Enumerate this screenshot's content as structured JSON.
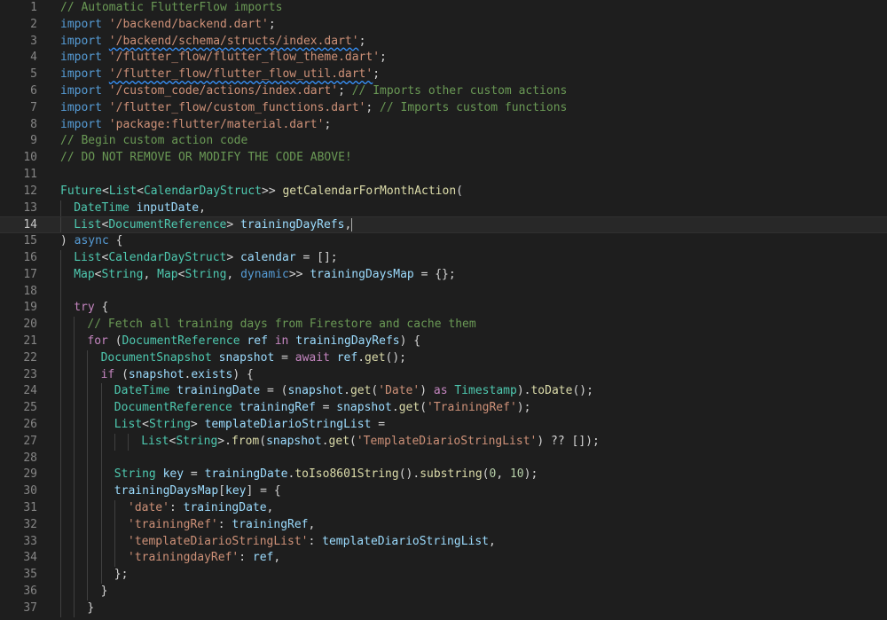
{
  "editor": {
    "current_line": 14,
    "colors": {
      "background": "#1e1e1e",
      "comment": "#6a9955",
      "keyword": "#569cd6",
      "control": "#c586c0",
      "string": "#ce9178",
      "type": "#4ec9b0",
      "function": "#dcdcaa",
      "variable": "#9cdcfe",
      "number": "#b5cea8",
      "plain": "#d4d4d4"
    },
    "lines": [
      {
        "n": "1",
        "tokens": [
          [
            "com",
            "// Automatic FlutterFlow imports"
          ]
        ]
      },
      {
        "n": "2",
        "tokens": [
          [
            "kw",
            "import"
          ],
          [
            "pun",
            " "
          ],
          [
            "str",
            "'/backend/backend.dart'"
          ],
          [
            "pun",
            ";"
          ]
        ]
      },
      {
        "n": "3",
        "tokens": [
          [
            "kw",
            "import"
          ],
          [
            "pun",
            " "
          ],
          [
            "str",
            "'/backend/schema/structs/index.dart'",
            "squig"
          ],
          [
            "pun",
            ";"
          ]
        ]
      },
      {
        "n": "4",
        "tokens": [
          [
            "kw",
            "import"
          ],
          [
            "pun",
            " "
          ],
          [
            "str",
            "'/flutter_flow/flutter_flow_theme.dart'"
          ],
          [
            "pun",
            ";"
          ]
        ]
      },
      {
        "n": "5",
        "tokens": [
          [
            "kw",
            "import"
          ],
          [
            "pun",
            " "
          ],
          [
            "str",
            "'/flutter_flow/flutter_flow_util.dart'",
            "squig"
          ],
          [
            "pun",
            ";"
          ]
        ]
      },
      {
        "n": "6",
        "tokens": [
          [
            "kw",
            "import"
          ],
          [
            "pun",
            " "
          ],
          [
            "str",
            "'/custom_code/actions/index.dart'"
          ],
          [
            "pun",
            "; "
          ],
          [
            "com",
            "// Imports other custom actions"
          ]
        ]
      },
      {
        "n": "7",
        "tokens": [
          [
            "kw",
            "import"
          ],
          [
            "pun",
            " "
          ],
          [
            "str",
            "'/flutter_flow/custom_functions.dart'"
          ],
          [
            "pun",
            "; "
          ],
          [
            "com",
            "// Imports custom functions"
          ]
        ]
      },
      {
        "n": "8",
        "tokens": [
          [
            "kw",
            "import"
          ],
          [
            "pun",
            " "
          ],
          [
            "str",
            "'package:flutter/material.dart'"
          ],
          [
            "pun",
            ";"
          ]
        ]
      },
      {
        "n": "9",
        "tokens": [
          [
            "com",
            "// Begin custom action code"
          ]
        ]
      },
      {
        "n": "10",
        "tokens": [
          [
            "com",
            "// DO NOT REMOVE OR MODIFY THE CODE ABOVE!"
          ]
        ]
      },
      {
        "n": "11",
        "tokens": []
      },
      {
        "n": "12",
        "tokens": [
          [
            "typ",
            "Future"
          ],
          [
            "pun",
            "<"
          ],
          [
            "typ",
            "List"
          ],
          [
            "pun",
            "<"
          ],
          [
            "typ",
            "CalendarDayStruct"
          ],
          [
            "pun",
            ">> "
          ],
          [
            "fn",
            "getCalendarForMonthAction"
          ],
          [
            "pun",
            "("
          ]
        ]
      },
      {
        "n": "13",
        "indent": 1,
        "tokens": [
          [
            "typ",
            "DateTime"
          ],
          [
            "pun",
            " "
          ],
          [
            "var",
            "inputDate"
          ],
          [
            "pun",
            ","
          ]
        ]
      },
      {
        "n": "14",
        "indent": 1,
        "tokens": [
          [
            "typ",
            "List"
          ],
          [
            "pun",
            "<"
          ],
          [
            "typ",
            "DocumentReference"
          ],
          [
            "pun",
            "> "
          ],
          [
            "var",
            "trainingDayRefs"
          ],
          [
            "pun",
            ","
          ]
        ],
        "cursor": true
      },
      {
        "n": "15",
        "tokens": [
          [
            "pun",
            ") "
          ],
          [
            "kw",
            "async"
          ],
          [
            "pun",
            " {"
          ]
        ]
      },
      {
        "n": "16",
        "indent": 1,
        "tokens": [
          [
            "typ",
            "List"
          ],
          [
            "pun",
            "<"
          ],
          [
            "typ",
            "CalendarDayStruct"
          ],
          [
            "pun",
            "> "
          ],
          [
            "var",
            "calendar"
          ],
          [
            "pun",
            " = [];"
          ]
        ]
      },
      {
        "n": "17",
        "indent": 1,
        "tokens": [
          [
            "typ",
            "Map"
          ],
          [
            "pun",
            "<"
          ],
          [
            "typ",
            "String"
          ],
          [
            "pun",
            ", "
          ],
          [
            "typ",
            "Map"
          ],
          [
            "pun",
            "<"
          ],
          [
            "typ",
            "String"
          ],
          [
            "pun",
            ", "
          ],
          [
            "kw",
            "dynamic"
          ],
          [
            "pun",
            ">> "
          ],
          [
            "var",
            "trainingDaysMap"
          ],
          [
            "pun",
            " = {};"
          ]
        ]
      },
      {
        "n": "18",
        "indent": 1,
        "tokens": []
      },
      {
        "n": "19",
        "indent": 1,
        "tokens": [
          [
            "ctl",
            "try"
          ],
          [
            "pun",
            " {"
          ]
        ]
      },
      {
        "n": "20",
        "indent": 2,
        "tokens": [
          [
            "com",
            "// Fetch all training days from Firestore and cache them"
          ]
        ]
      },
      {
        "n": "21",
        "indent": 2,
        "tokens": [
          [
            "ctl",
            "for"
          ],
          [
            "pun",
            " ("
          ],
          [
            "typ",
            "DocumentReference"
          ],
          [
            "pun",
            " "
          ],
          [
            "var",
            "ref"
          ],
          [
            "pun",
            " "
          ],
          [
            "ctl",
            "in"
          ],
          [
            "pun",
            " "
          ],
          [
            "var",
            "trainingDayRefs"
          ],
          [
            "pun",
            ") {"
          ]
        ]
      },
      {
        "n": "22",
        "indent": 3,
        "tokens": [
          [
            "typ",
            "DocumentSnapshot"
          ],
          [
            "pun",
            " "
          ],
          [
            "var",
            "snapshot"
          ],
          [
            "pun",
            " = "
          ],
          [
            "ctl",
            "await"
          ],
          [
            "pun",
            " "
          ],
          [
            "var",
            "ref"
          ],
          [
            "pun",
            "."
          ],
          [
            "fn",
            "get"
          ],
          [
            "pun",
            "();"
          ]
        ]
      },
      {
        "n": "23",
        "indent": 3,
        "tokens": [
          [
            "ctl",
            "if"
          ],
          [
            "pun",
            " ("
          ],
          [
            "var",
            "snapshot"
          ],
          [
            "pun",
            "."
          ],
          [
            "var",
            "exists"
          ],
          [
            "pun",
            ") {"
          ]
        ]
      },
      {
        "n": "24",
        "indent": 4,
        "tokens": [
          [
            "typ",
            "DateTime"
          ],
          [
            "pun",
            " "
          ],
          [
            "var",
            "trainingDate"
          ],
          [
            "pun",
            " = ("
          ],
          [
            "var",
            "snapshot"
          ],
          [
            "pun",
            "."
          ],
          [
            "fn",
            "get"
          ],
          [
            "pun",
            "("
          ],
          [
            "str",
            "'Date'"
          ],
          [
            "pun",
            ") "
          ],
          [
            "ctl",
            "as"
          ],
          [
            "pun",
            " "
          ],
          [
            "typ",
            "Timestamp"
          ],
          [
            "pun",
            ")."
          ],
          [
            "fn",
            "toDate"
          ],
          [
            "pun",
            "();"
          ]
        ]
      },
      {
        "n": "25",
        "indent": 4,
        "tokens": [
          [
            "typ",
            "DocumentReference"
          ],
          [
            "pun",
            " "
          ],
          [
            "var",
            "trainingRef"
          ],
          [
            "pun",
            " = "
          ],
          [
            "var",
            "snapshot"
          ],
          [
            "pun",
            "."
          ],
          [
            "fn",
            "get"
          ],
          [
            "pun",
            "("
          ],
          [
            "str",
            "'TrainingRef'"
          ],
          [
            "pun",
            ");"
          ]
        ]
      },
      {
        "n": "26",
        "indent": 4,
        "tokens": [
          [
            "typ",
            "List"
          ],
          [
            "pun",
            "<"
          ],
          [
            "typ",
            "String"
          ],
          [
            "pun",
            "> "
          ],
          [
            "var",
            "templateDiarioStringList"
          ],
          [
            "pun",
            " ="
          ]
        ]
      },
      {
        "n": "27",
        "indent": 6,
        "tokens": [
          [
            "typ",
            "List"
          ],
          [
            "pun",
            "<"
          ],
          [
            "typ",
            "String"
          ],
          [
            "pun",
            ">."
          ],
          [
            "fn",
            "from"
          ],
          [
            "pun",
            "("
          ],
          [
            "var",
            "snapshot"
          ],
          [
            "pun",
            "."
          ],
          [
            "fn",
            "get"
          ],
          [
            "pun",
            "("
          ],
          [
            "str",
            "'TemplateDiarioStringList'"
          ],
          [
            "pun",
            ") ?? []);"
          ]
        ]
      },
      {
        "n": "28",
        "indent": 4,
        "tokens": []
      },
      {
        "n": "29",
        "indent": 4,
        "tokens": [
          [
            "typ",
            "String"
          ],
          [
            "pun",
            " "
          ],
          [
            "var",
            "key"
          ],
          [
            "pun",
            " = "
          ],
          [
            "var",
            "trainingDate"
          ],
          [
            "pun",
            "."
          ],
          [
            "fn",
            "toIso8601String"
          ],
          [
            "pun",
            "()."
          ],
          [
            "fn",
            "substring"
          ],
          [
            "pun",
            "("
          ],
          [
            "num",
            "0"
          ],
          [
            "pun",
            ", "
          ],
          [
            "num",
            "10"
          ],
          [
            "pun",
            ");"
          ]
        ]
      },
      {
        "n": "30",
        "indent": 4,
        "tokens": [
          [
            "var",
            "trainingDaysMap"
          ],
          [
            "pun",
            "["
          ],
          [
            "var",
            "key"
          ],
          [
            "pun",
            "] = {"
          ]
        ]
      },
      {
        "n": "31",
        "indent": 5,
        "tokens": [
          [
            "str",
            "'date'"
          ],
          [
            "pun",
            ": "
          ],
          [
            "var",
            "trainingDate"
          ],
          [
            "pun",
            ","
          ]
        ]
      },
      {
        "n": "32",
        "indent": 5,
        "tokens": [
          [
            "str",
            "'trainingRef'"
          ],
          [
            "pun",
            ": "
          ],
          [
            "var",
            "trainingRef"
          ],
          [
            "pun",
            ","
          ]
        ]
      },
      {
        "n": "33",
        "indent": 5,
        "tokens": [
          [
            "str",
            "'templateDiarioStringList'"
          ],
          [
            "pun",
            ": "
          ],
          [
            "var",
            "templateDiarioStringList"
          ],
          [
            "pun",
            ","
          ]
        ]
      },
      {
        "n": "34",
        "indent": 5,
        "tokens": [
          [
            "str",
            "'trainingdayRef'"
          ],
          [
            "pun",
            ": "
          ],
          [
            "var",
            "ref"
          ],
          [
            "pun",
            ","
          ]
        ]
      },
      {
        "n": "35",
        "indent": 4,
        "tokens": [
          [
            "pun",
            "};"
          ]
        ]
      },
      {
        "n": "36",
        "indent": 3,
        "tokens": [
          [
            "pun",
            "}"
          ]
        ]
      },
      {
        "n": "37",
        "indent": 2,
        "tokens": [
          [
            "pun",
            "}"
          ]
        ]
      }
    ]
  }
}
